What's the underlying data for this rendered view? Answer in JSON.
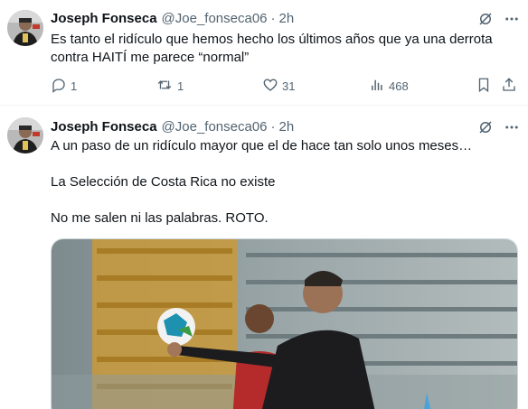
{
  "tweets": [
    {
      "author": {
        "name": "Joseph Fonseca",
        "handle": "@Joe_fonseca06"
      },
      "time": "2h",
      "text": "Es tanto el ridículo que hemos hecho los últimos años que ya una derrota contra HAITÍ me parece “normal”",
      "stats": {
        "replies": "1",
        "reposts": "1",
        "likes": "31",
        "views": "468"
      }
    },
    {
      "author": {
        "name": "Joseph Fonseca",
        "handle": "@Joe_fonseca06"
      },
      "time": "2h",
      "lines": [
        "A un paso de un ridículo mayor que el de hace tan solo unos meses…",
        "La Selección de Costa Rica no existe",
        "No me salen ni las palabras. ROTO."
      ]
    }
  ],
  "separator": "·",
  "colors": {
    "text": "#0f1419",
    "secondary": "#536471",
    "divider": "#eff3f4"
  }
}
